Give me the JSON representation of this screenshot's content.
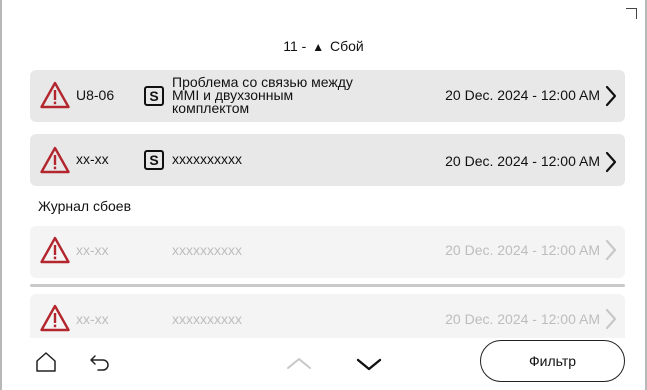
{
  "header": {
    "count": "11",
    "separator": "-",
    "title": "Сбой"
  },
  "active_faults": [
    {
      "code": "U8-06",
      "badge": "S",
      "desc_lines": [
        "Проблема со связью между",
        "MMI и двухзонным",
        "комплектом"
      ],
      "date": "20 Dec. 2024 - 12:00 AM"
    },
    {
      "code": "xx-xx",
      "badge": "S",
      "desc_lines": [
        "xxxxxxxxxx"
      ],
      "date": "20 Dec. 2024 - 12:00 AM"
    }
  ],
  "journal": {
    "title": "Журнал сбоев",
    "rows": [
      {
        "code": "xx-xx",
        "desc": "xxxxxxxxxx",
        "date": "20 Dec. 2024 - 12:00 AM"
      },
      {
        "code": "xx-xx",
        "desc": "xxxxxxxxxx",
        "date": "20 Dec. 2024 - 12:00 AM"
      }
    ]
  },
  "footer": {
    "filter_label": "Фильтр",
    "icons": [
      "home-icon",
      "back-icon",
      "scroll-up-icon",
      "scroll-down-icon"
    ]
  },
  "colors": {
    "alert_red": "#b3262e",
    "row_bg": "#e8e8e8",
    "row_bg_faded": "#f4f4f4",
    "faded_text": "#bdbdbd"
  }
}
